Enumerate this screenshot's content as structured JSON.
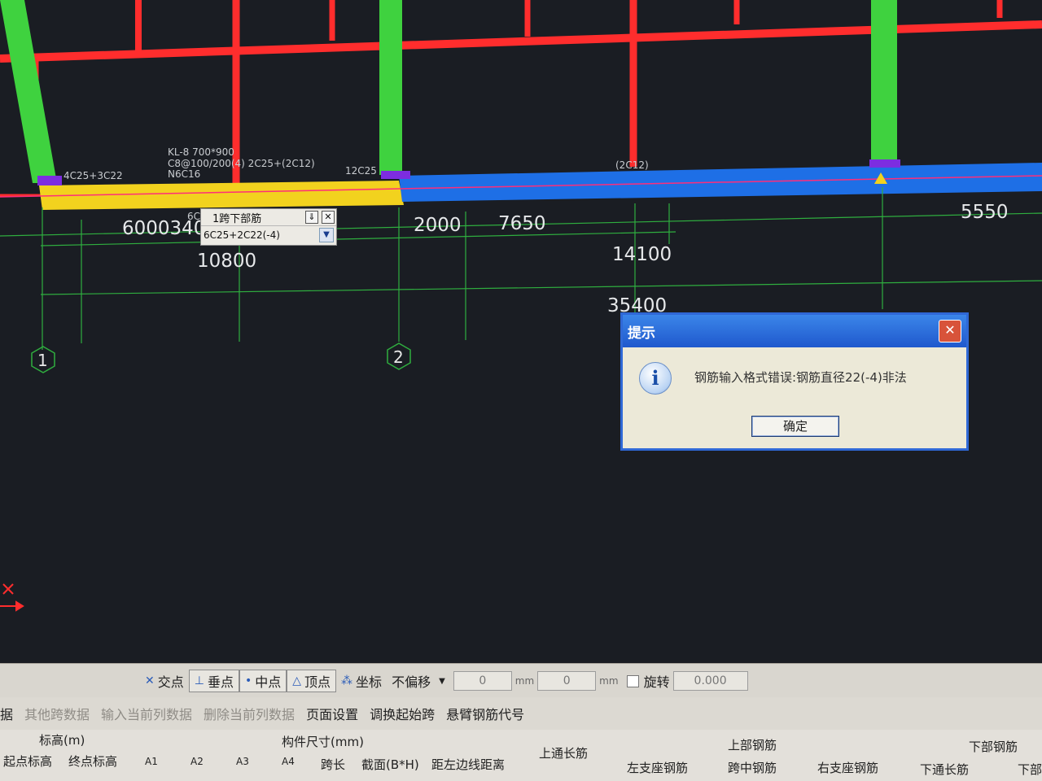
{
  "drawing": {
    "dimensions": {
      "d_6000_340": "6000340",
      "d_2000": "2000",
      "d_7650": "7650",
      "d_5550": "5550",
      "d_10800": "10800",
      "d_14100": "14100",
      "d_35400": "35400"
    },
    "annotations": {
      "beam_name": "KL-8 700*900",
      "stirrup": "C8@100/200(4) 2C25+(2C12)",
      "side_bars": "N6C16",
      "top_left": "4C25+3C22",
      "top_mid": "12C25",
      "top_right": "(2C12)",
      "dim_fragment": "6C"
    },
    "axes": [
      "1",
      "2"
    ],
    "colors": {
      "column": "#ff2d2d",
      "beam_selected": "#f2d21e",
      "beam": "#1e6fe6",
      "wall": "#3fd23f",
      "grid": "#2fae3f"
    }
  },
  "rebar_editor": {
    "title": "1跨下部筋",
    "value": "6C25+2C22(-4)",
    "collapse_icon": "collapse-icon",
    "close_icon": "close-icon"
  },
  "dialog": {
    "title": "提示",
    "message": "钢筋输入格式错误:钢筋直径22(-4)非法",
    "ok_label": "确定",
    "icon": "info-icon"
  },
  "snap_toolbar": {
    "intersection": "交点",
    "perpendicular": "垂点",
    "midpoint": "中点",
    "vertex": "顶点",
    "coordinate": "坐标",
    "offset_mode": "不偏移",
    "x_value": "0",
    "y_value": "0",
    "rotate_label": "旋转",
    "rotate_value": "0.000",
    "unit": "mm"
  },
  "menu": {
    "cut": "据",
    "disabled": [
      "其他跨数据",
      "输入当前列数据",
      "删除当前列数据"
    ],
    "items": [
      "页面设置",
      "调换起始跨",
      "悬臂钢筋代号"
    ]
  },
  "grid_header": {
    "elevation_group": "标高(m)",
    "start_elev": "起点标高",
    "end_elev": "终点标高",
    "a1": "A1",
    "a2": "A2",
    "a3": "A3",
    "a4": "A4",
    "size_group": "构件尺寸(mm)",
    "span_len": "跨长",
    "section": "截面(B*H)",
    "left_edge": "距左边线距离",
    "top_through": "上通长筋",
    "top_group": "上部钢筋",
    "left_support": "左支座钢筋",
    "mid_span": "跨中钢筋",
    "right_support": "右支座钢筋",
    "bottom_group": "下部钢筋",
    "bottom_through": "下通长筋",
    "bottom_cut": "下部"
  }
}
